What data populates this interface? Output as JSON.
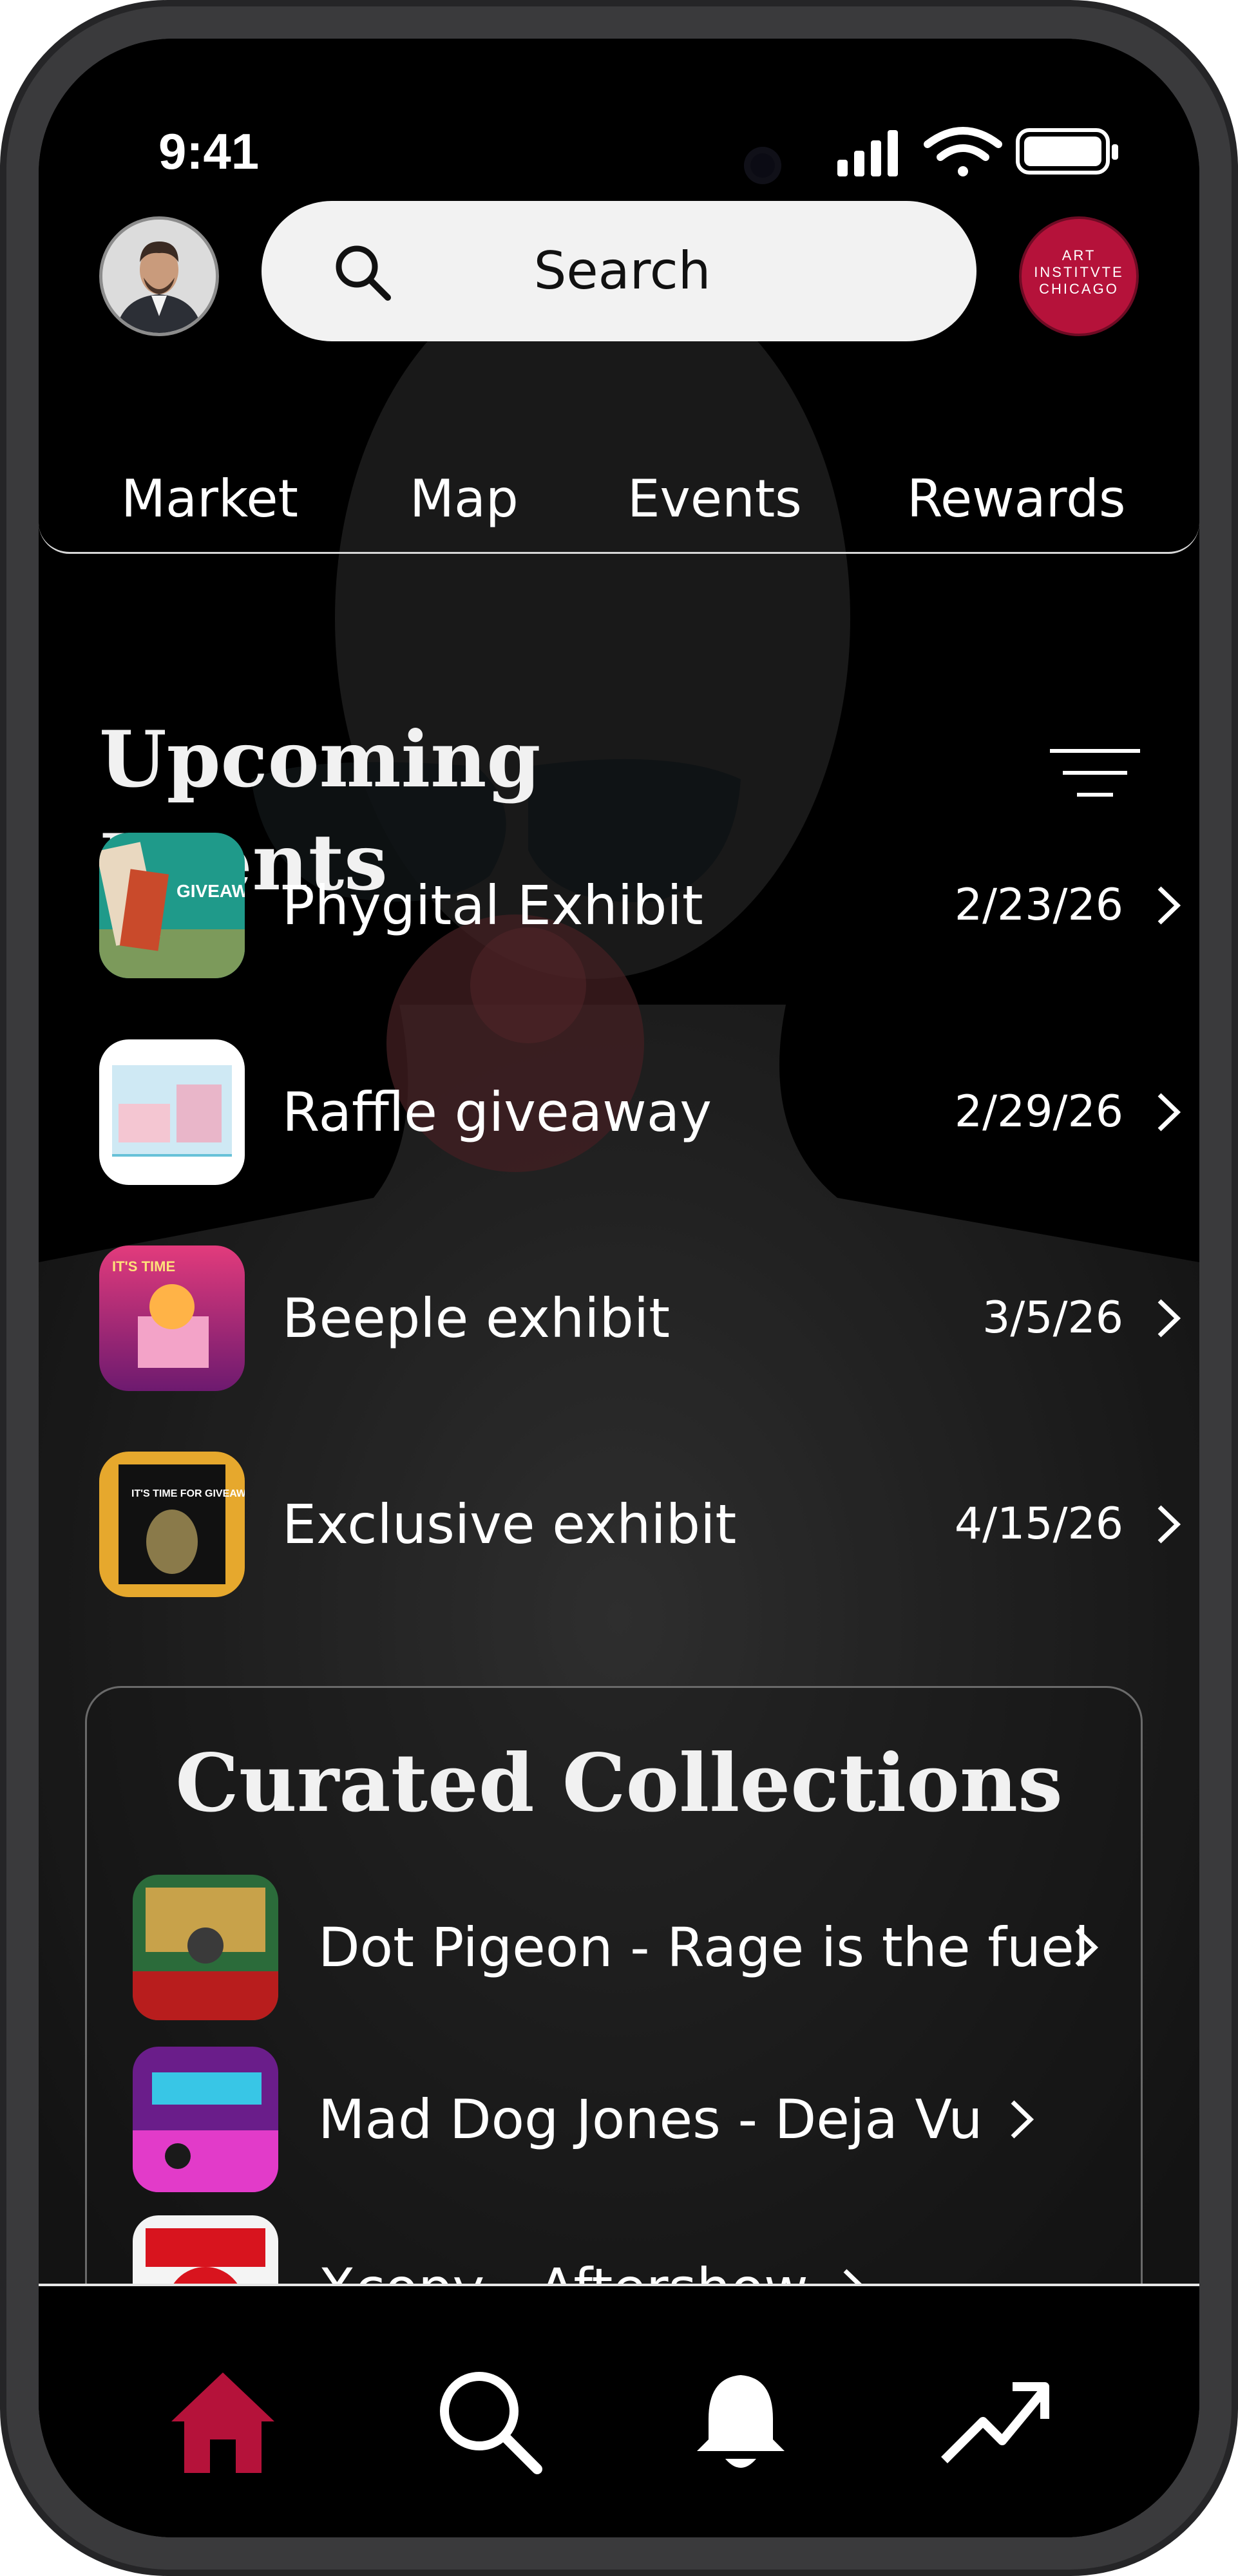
{
  "status_bar": {
    "time": "9:41"
  },
  "header": {
    "search_placeholder": "Search",
    "logo_lines": [
      "ART",
      "INSTITVTE",
      "CHICAGO"
    ]
  },
  "tabs": [
    {
      "label": "Market"
    },
    {
      "label": "Map"
    },
    {
      "label": "Events"
    },
    {
      "label": "Rewards"
    }
  ],
  "upcoming_events": {
    "title": "Upcoming Events",
    "items": [
      {
        "name": "Phygital Exhibit",
        "date": "2/23/26",
        "thumb_text": "GIVEAWAY EVENT"
      },
      {
        "name": "Raffle giveaway",
        "date": "2/29/26"
      },
      {
        "name": "Beeple exhibit",
        "date": "3/5/26",
        "thumb_text": "IT'S TIME"
      },
      {
        "name": "Exclusive exhibit",
        "date": "4/15/26",
        "thumb_text": "IT'S TIME FOR GIVEAWAY"
      }
    ]
  },
  "curated_collections": {
    "title": "Curated Collections",
    "items": [
      {
        "name": "Dot Pigeon - Rage is the fuel"
      },
      {
        "name": "Mad Dog Jones - Deja Vu"
      },
      {
        "name": "Xcopy - Aftershow"
      }
    ]
  },
  "bottom_nav": {
    "items": [
      {
        "icon": "home-icon",
        "active": true
      },
      {
        "icon": "search-icon"
      },
      {
        "icon": "bell-icon"
      },
      {
        "icon": "trending-icon"
      }
    ],
    "active_color": "#b5123a"
  }
}
